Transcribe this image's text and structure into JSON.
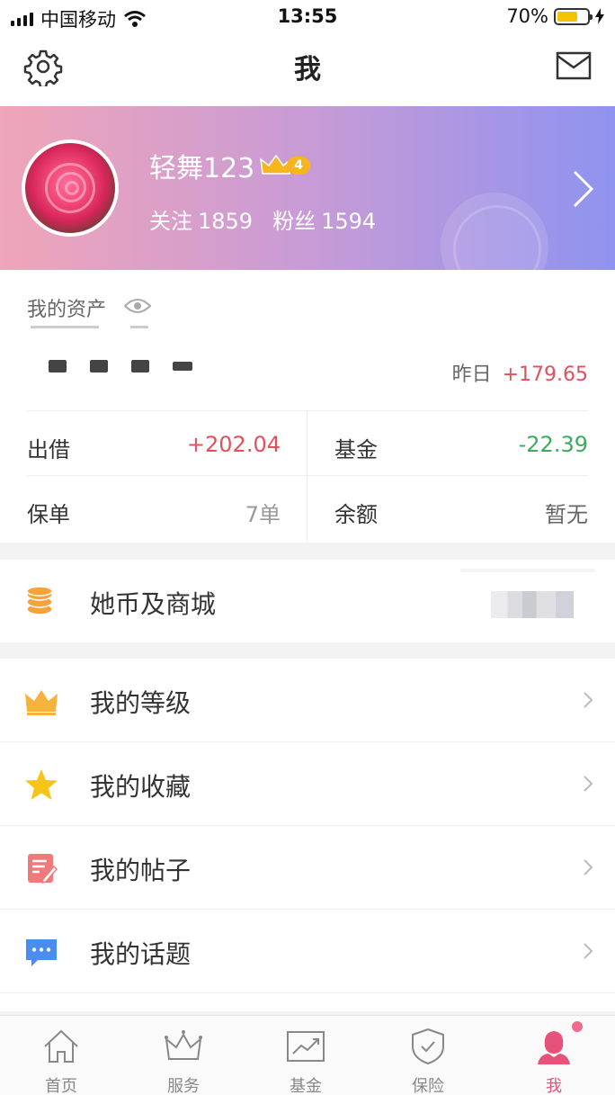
{
  "status_bar": {
    "carrier": "中国移动",
    "time": "13:55",
    "battery": "70%",
    "battery_level": 0.7
  },
  "nav": {
    "title": "我",
    "settings_icon": "gear-icon",
    "mail_icon": "mail-icon"
  },
  "profile": {
    "username": "轻舞123",
    "level": "4",
    "follow_label": "关注",
    "follow_count": "1859",
    "fans_label": "粉丝",
    "fans_count": "1594"
  },
  "assets": {
    "title": "我的资产",
    "yesterday_label": "昨日",
    "yesterday_value": "+179.65",
    "cells": [
      {
        "label": "出借",
        "value": "+202.04",
        "color": "#e0515d"
      },
      {
        "label": "基金",
        "value": "-22.39",
        "color": "#3cab5c"
      },
      {
        "label": "保单",
        "value": "7单",
        "color": "#999999"
      },
      {
        "label": "余额",
        "value": "暂无",
        "color": "#666666"
      }
    ]
  },
  "coins": {
    "label": "她币及商城",
    "icon": "coins-icon"
  },
  "menu": [
    {
      "label": "我的等级",
      "icon": "crown-icon"
    },
    {
      "label": "我的收藏",
      "icon": "star-icon"
    },
    {
      "label": "我的帖子",
      "icon": "post-icon"
    },
    {
      "label": "我的话题",
      "icon": "chat-icon"
    }
  ],
  "tabs": [
    {
      "label": "首页",
      "icon": "home-icon"
    },
    {
      "label": "服务",
      "icon": "crown-outline-icon"
    },
    {
      "label": "基金",
      "icon": "chart-icon"
    },
    {
      "label": "保险",
      "icon": "shield-icon"
    },
    {
      "label": "我",
      "icon": "user-icon",
      "active": true
    }
  ],
  "colors": {
    "accent": "#e6527a",
    "positive": "#e0515d",
    "negative": "#3cab5c"
  }
}
